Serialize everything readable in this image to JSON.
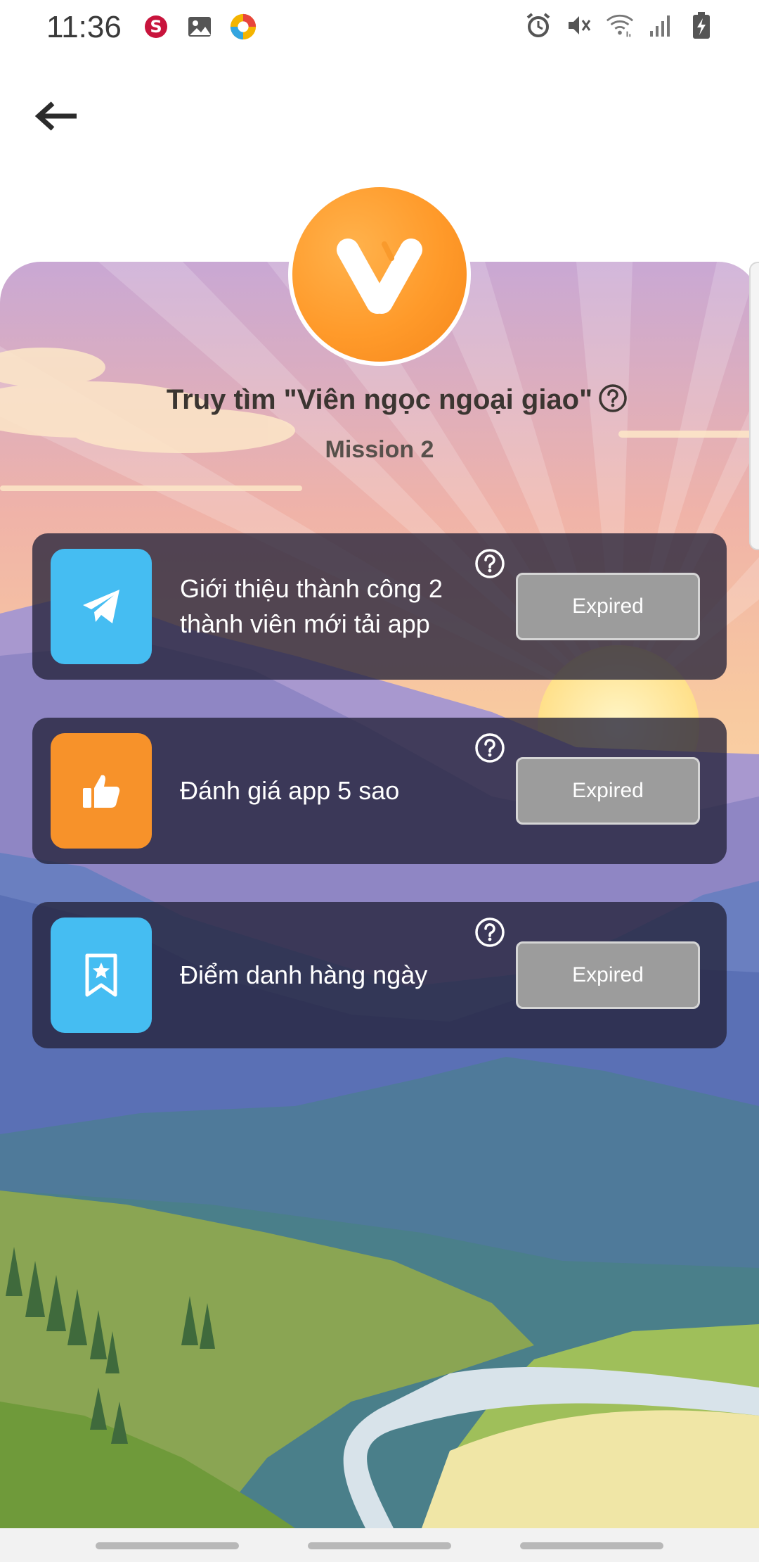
{
  "status_bar": {
    "time": "11:36",
    "left_icons": [
      "s-app-icon",
      "gallery-icon",
      "browser-icon"
    ],
    "right_icons": [
      "alarm-icon",
      "mute-icon",
      "wifi-icon",
      "signal-icon",
      "battery-icon"
    ]
  },
  "header": {
    "back_icon": "back-arrow-icon"
  },
  "mission": {
    "title": "Truy tìm \"Viên ngọc ngoại giao\"",
    "subtitle": "Mission 2",
    "help_icon": "question-circle-icon"
  },
  "tasks": [
    {
      "label": "Giới thiệu thành công 2 thành viên mới tải app",
      "icon": "paper-plane-icon",
      "icon_color": "#45bdf2",
      "button": "Expired"
    },
    {
      "label": "Đánh giá app 5 sao",
      "icon": "thumbs-up-icon",
      "icon_color": "#f7922a",
      "button": "Expired"
    },
    {
      "label": "Điểm danh hàng ngày",
      "icon": "bookmark-star-icon",
      "icon_color": "#45bdf2",
      "button": "Expired"
    }
  ],
  "colors": {
    "accent_orange": "#f7922a",
    "accent_blue": "#45bdf2",
    "expired_gray": "#9c9c9c"
  }
}
